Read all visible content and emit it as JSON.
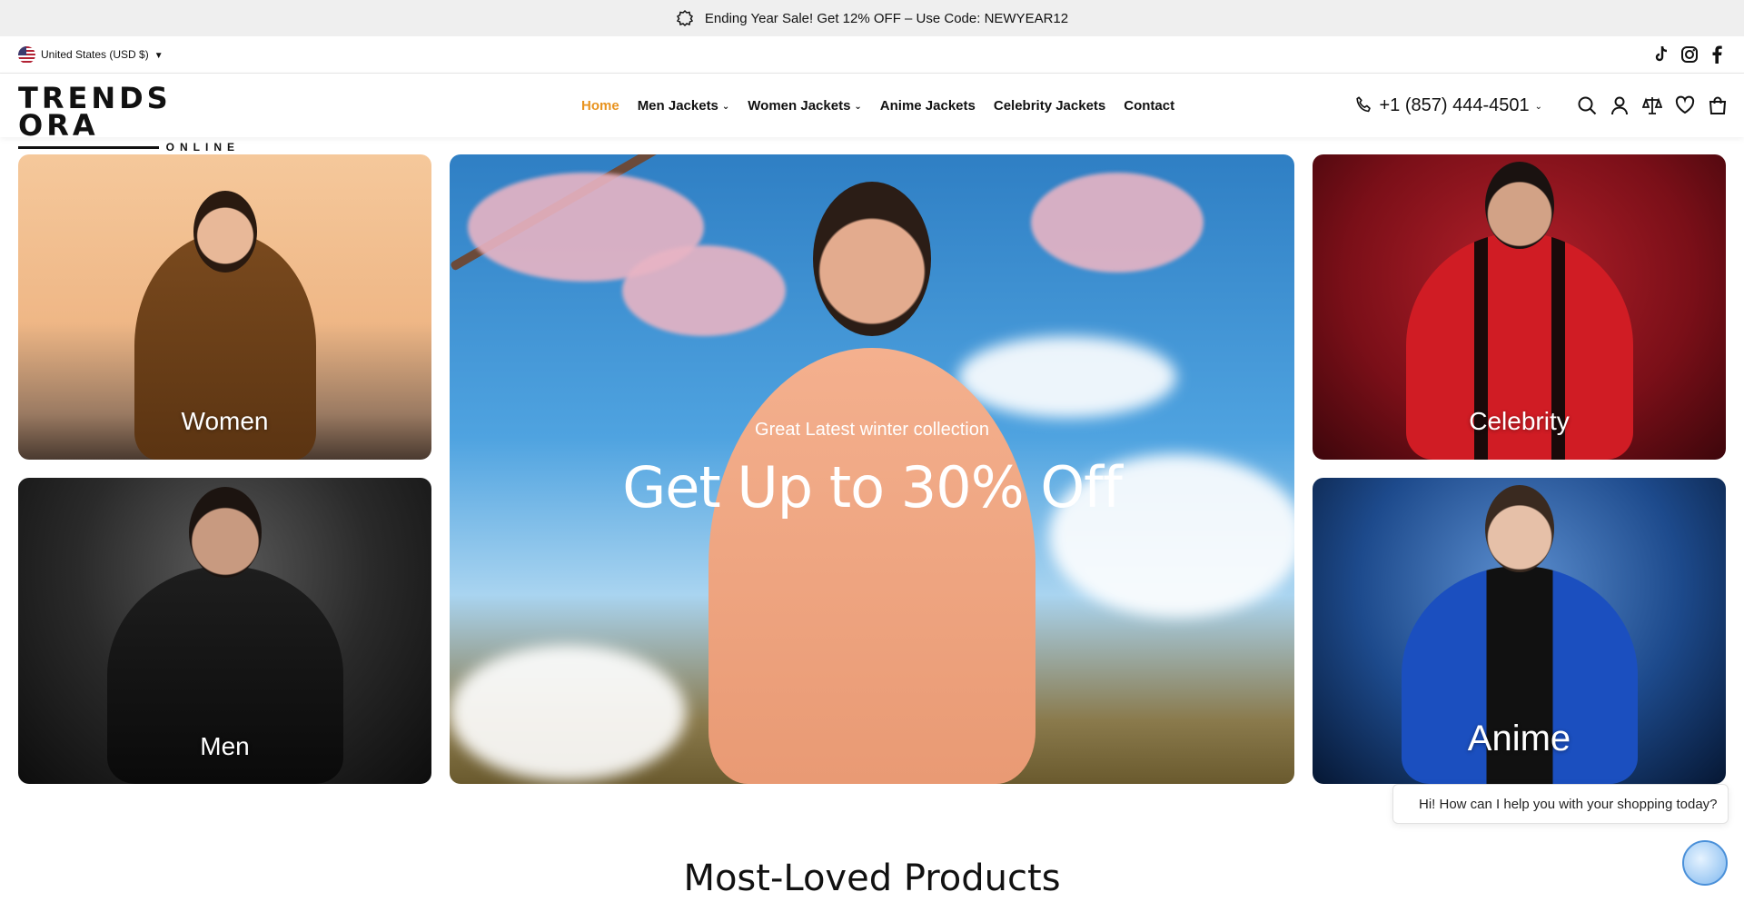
{
  "announcement": {
    "text": "Ending Year Sale! Get 12% OFF – Use Code: NEWYEAR12",
    "icon": "sale-badge-icon"
  },
  "utility": {
    "locale": "United States (USD $)",
    "social": [
      "tiktok-icon",
      "instagram-icon",
      "facebook-icon"
    ]
  },
  "header": {
    "logo_top": "TRENDS ORA",
    "logo_bottom": "ONLINE",
    "nav": [
      {
        "label": "Home",
        "active": true
      },
      {
        "label": "Men Jackets",
        "dropdown": true
      },
      {
        "label": "Women Jackets",
        "dropdown": true
      },
      {
        "label": "Anime Jackets"
      },
      {
        "label": "Celebrity Jackets"
      },
      {
        "label": "Contact"
      }
    ],
    "phone": "+1 (857) 444-4501",
    "accent_color": "#e8931f"
  },
  "tiles": {
    "women": "Women",
    "men": "Men",
    "celebrity": "Celebrity",
    "anime": "Anime"
  },
  "hero": {
    "subtitle": "Great Latest winter collection",
    "title": "Get Up to 30% Off"
  },
  "chat": {
    "message": "Hi! How can I help you with your shopping today?"
  },
  "section": {
    "title": "Most-Loved Products"
  }
}
